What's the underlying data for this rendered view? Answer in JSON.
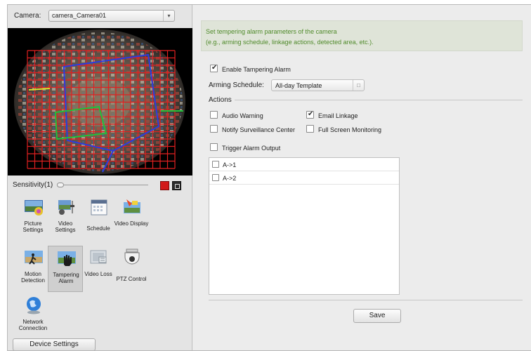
{
  "camera": {
    "label": "Camera:",
    "selected": "camera_Camera01"
  },
  "sensitivity": {
    "label": "Sensitivity(1)",
    "level": 0.0
  },
  "tools": [
    {
      "name": "picture-settings",
      "label": "Picture Settings",
      "icon": "picture-settings-icon"
    },
    {
      "name": "video-settings",
      "label": "Video Settings",
      "icon": "video-settings-icon"
    },
    {
      "name": "schedule",
      "label": "Schedule",
      "icon": "calendar-icon"
    },
    {
      "name": "video-display",
      "label": "Video Display",
      "icon": "video-display-icon"
    },
    {
      "name": "motion-detection",
      "label": "Motion Detection",
      "icon": "motion-detection-icon"
    },
    {
      "name": "tampering-alarm",
      "label": "Tampering Alarm",
      "icon": "tampering-hand-icon"
    },
    {
      "name": "video-loss",
      "label": "Video Loss",
      "icon": "video-loss-icon"
    },
    {
      "name": "ptz-control",
      "label": "PTZ Control",
      "icon": "dome-camera-icon"
    },
    {
      "name": "network-connection",
      "label": "Network Connection",
      "icon": "globe-icon"
    }
  ],
  "device_settings_label": "Device Settings",
  "hint": {
    "line1": "Set tempering alarm parameters of the camera",
    "line2": "(e.g., arming schedule, linkage actions, detected area, etc.)."
  },
  "enable": {
    "label": "Enable Tampering Alarm",
    "checked": true
  },
  "arming": {
    "label": "Arming Schedule:",
    "value": "All-day Template"
  },
  "actions": {
    "title": "Actions",
    "audio_warning": {
      "label": "Audio Warning",
      "checked": false
    },
    "email_linkage": {
      "label": "Email Linkage",
      "checked": true
    },
    "notify_center": {
      "label": "Notify Surveillance Center",
      "checked": false
    },
    "full_screen": {
      "label": "Full Screen Monitoring",
      "checked": false
    },
    "trigger_output": {
      "label": "Trigger Alarm Output",
      "checked": false
    }
  },
  "alarm_outputs": [
    {
      "label": "A->1",
      "checked": false
    },
    {
      "label": "A->2",
      "checked": false
    }
  ],
  "save_label": "Save",
  "colors": {
    "hint_text": "#4f8a2a",
    "grid_red": "#e02020",
    "region_blue": "#2b3ce0",
    "region_green": "#1fc23a"
  }
}
